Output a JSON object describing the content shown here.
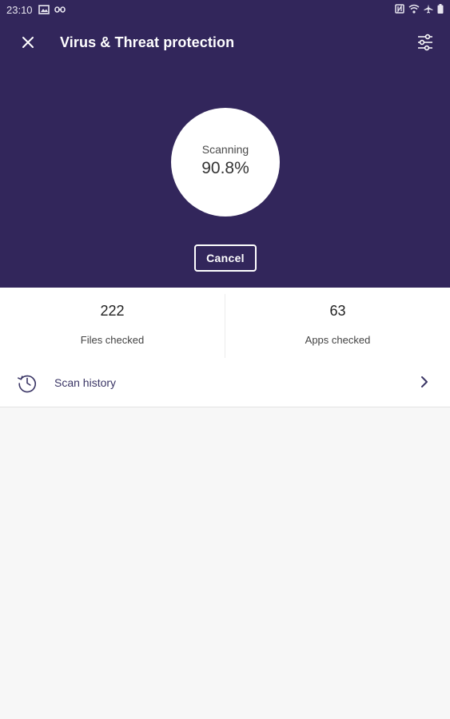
{
  "status_bar": {
    "time": "23:10"
  },
  "header": {
    "title": "Virus & Threat protection"
  },
  "scan": {
    "label": "Scanning",
    "percent": "90.8%",
    "cancel_label": "Cancel"
  },
  "stats": [
    {
      "value": "222",
      "label": "Files checked"
    },
    {
      "value": "63",
      "label": "Apps checked"
    }
  ],
  "history": {
    "label": "Scan history"
  },
  "colors": {
    "header_bg": "#32265b",
    "surface": "#ffffff",
    "background": "#f7f7f7",
    "link_text": "#3a3565"
  },
  "icons": {
    "close": "close-icon",
    "filter": "filter-settings-icon",
    "history": "history-clock-icon",
    "chevron": "chevron-right-icon"
  }
}
